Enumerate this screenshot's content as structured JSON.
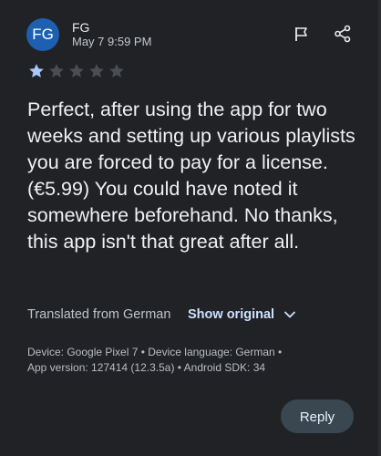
{
  "review": {
    "author_initials": "FG",
    "author_name": "FG",
    "date": "May 7 9:59 PM",
    "rating": 1,
    "rating_max": 5,
    "text": "Perfect, after using the app for two weeks and setting up various playlists you are forced to pay for a license. (€5.99) You could have noted it somewhere beforehand. No thanks, this app isn't that great after all.",
    "translated_label": "Translated from German",
    "show_original_label": "Show original",
    "meta_line1": "Device: Google Pixel 7 • Device language: German •",
    "meta_line2": "App version: 127414 (12.3.5a) • Android SDK: 34",
    "reply_label": "Reply"
  },
  "icons": {
    "flag": "flag-icon",
    "share": "share-icon",
    "chevron": "chevron-down-icon",
    "star": "star-icon"
  },
  "colors": {
    "background": "#202226",
    "avatar": "#1d5fb0",
    "star_filled": "#a8c7fa",
    "star_empty": "#4a4d52",
    "link": "#cfe1ff",
    "reply_bg": "#3a4750"
  }
}
